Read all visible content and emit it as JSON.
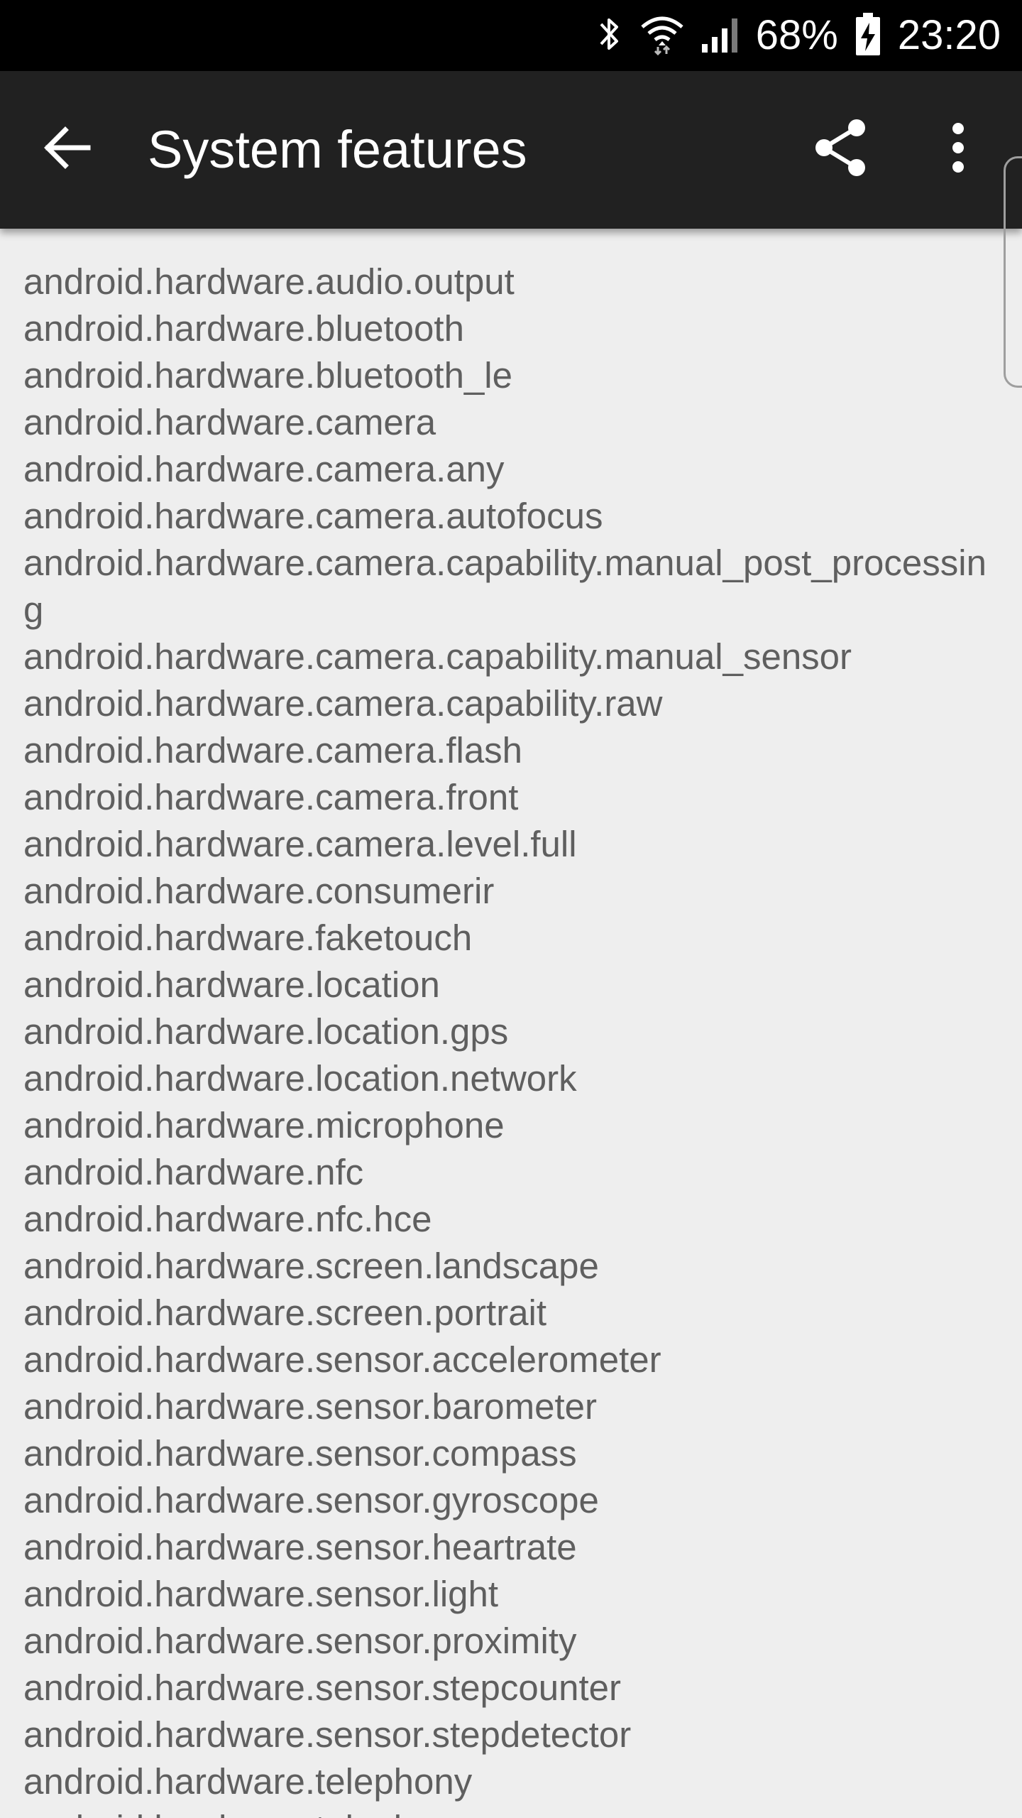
{
  "status_bar": {
    "battery_percent": "68%",
    "time": "23:20",
    "icons": [
      "bluetooth-icon",
      "wifi-icon",
      "signal-icon",
      "battery-charging-icon"
    ]
  },
  "app_bar": {
    "title": "System features",
    "back_icon": "arrow-back-icon",
    "share_icon": "share-icon",
    "more_icon": "more-vert-icon"
  },
  "features": [
    "android.hardware.audio.output",
    "android.hardware.bluetooth",
    "android.hardware.bluetooth_le",
    "android.hardware.camera",
    "android.hardware.camera.any",
    "android.hardware.camera.autofocus",
    "android.hardware.camera.capability.manual_post_processing",
    "android.hardware.camera.capability.manual_sensor",
    "android.hardware.camera.capability.raw",
    "android.hardware.camera.flash",
    "android.hardware.camera.front",
    "android.hardware.camera.level.full",
    "android.hardware.consumerir",
    "android.hardware.faketouch",
    "android.hardware.location",
    "android.hardware.location.gps",
    "android.hardware.location.network",
    "android.hardware.microphone",
    "android.hardware.nfc",
    "android.hardware.nfc.hce",
    "android.hardware.screen.landscape",
    "android.hardware.screen.portrait",
    "android.hardware.sensor.accelerometer",
    "android.hardware.sensor.barometer",
    "android.hardware.sensor.compass",
    "android.hardware.sensor.gyroscope",
    "android.hardware.sensor.heartrate",
    "android.hardware.sensor.light",
    "android.hardware.sensor.proximity",
    "android.hardware.sensor.stepcounter",
    "android.hardware.sensor.stepdetector",
    "android.hardware.telephony",
    "android.hardware.telephony.gsm"
  ],
  "colors": {
    "status_bar": "#000000",
    "app_bar": "#212121",
    "background": "#eeeeee",
    "text": "#5f5f5f"
  }
}
